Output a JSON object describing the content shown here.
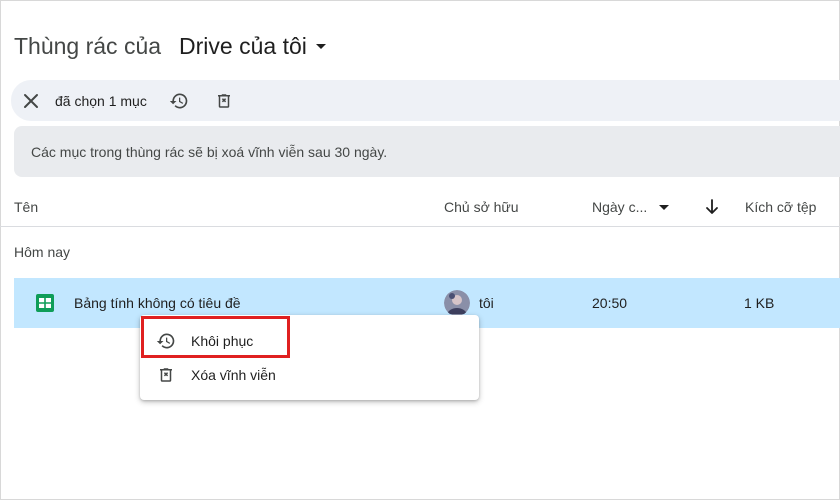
{
  "header": {
    "title_prefix": "Thùng rác của",
    "location": "Drive của tôi"
  },
  "selection_bar": {
    "count_label": "đã chọn 1 mục"
  },
  "banner": {
    "text": "Các mục trong thùng rác sẽ bị xoá vĩnh viễn sau 30 ngày."
  },
  "columns": {
    "name": "Tên",
    "owner": "Chủ sở hữu",
    "date": "Ngày c...",
    "size": "Kích cỡ tệp"
  },
  "section": {
    "label": "Hôm nay"
  },
  "file_row": {
    "name": "Bảng tính không có tiêu đề",
    "owner": "tôi",
    "time": "20:50",
    "size": "1 KB"
  },
  "context_menu": {
    "items": [
      {
        "label": "Khôi phục",
        "icon": "restore-icon"
      },
      {
        "label": "Xóa vĩnh viễn",
        "icon": "delete-forever-icon"
      }
    ]
  },
  "colors": {
    "row_selected": "#c2e7ff",
    "selection_bar": "#eef1f6",
    "banner": "#e9ebee",
    "highlight": "#e02020",
    "sheets_green": "#0f9d58"
  }
}
